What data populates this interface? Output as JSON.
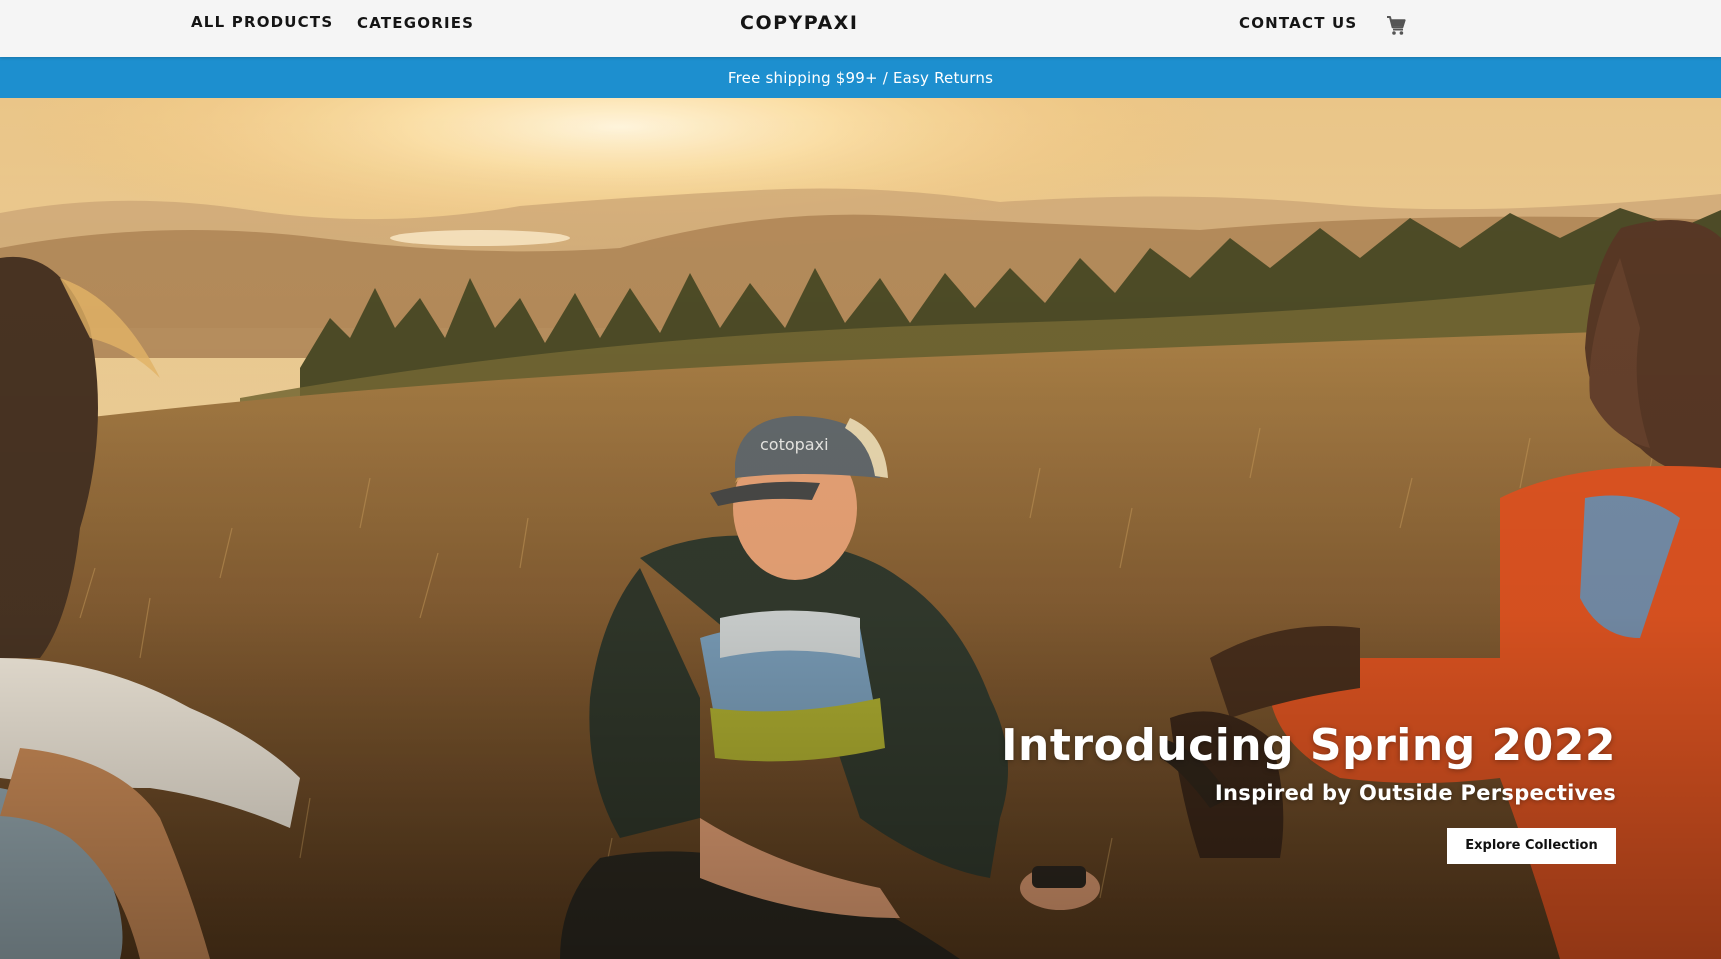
{
  "nav": {
    "all_products": "ALL PRODUCTS",
    "categories": "CATEGORIES",
    "logo": "COPYPAXI",
    "contact_us": "CONTACT US",
    "cart_icon": "shopping-cart-icon"
  },
  "announcement": {
    "text": "Free shipping $99+ / Easy Returns",
    "background": "#1d8fcf"
  },
  "hero": {
    "image_alt": "Three hikers sitting in golden grass at sunset",
    "cap_logo": "cotopaxi",
    "title": "Introducing Spring 2022",
    "subtitle": "Inspired by Outside Perspectives",
    "cta_label": "Explore Collection"
  },
  "colors": {
    "nav_background": "#f5f5f5",
    "accent_blue": "#1d8fcf",
    "hero_text": "#ffffff",
    "cta_background": "#ffffff"
  }
}
